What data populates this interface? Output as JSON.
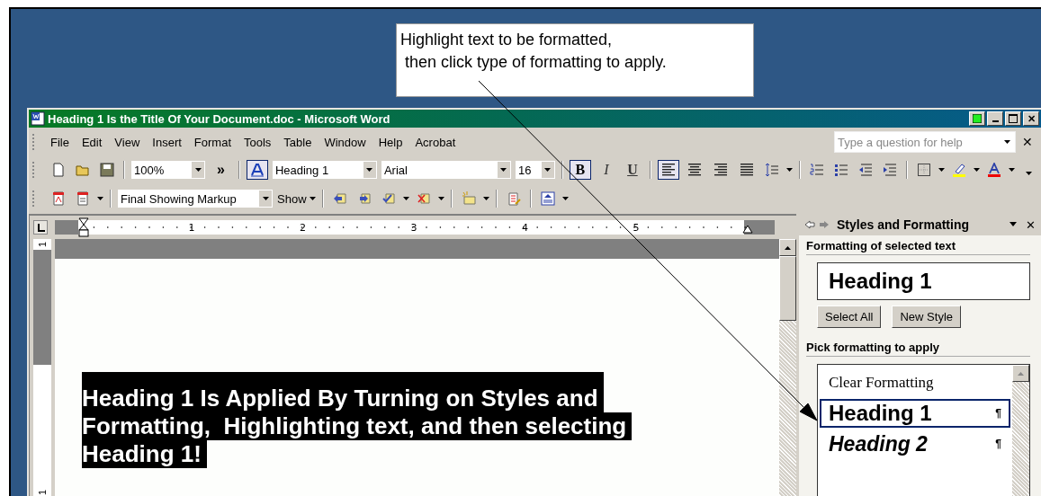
{
  "callout": {
    "lines": [
      "Highlight text to be formatted,",
      " then click type of formatting to apply."
    ]
  },
  "window": {
    "title": "Heading 1 Is the Title Of Your Document.doc - Microsoft Word",
    "close": "✕"
  },
  "menu": [
    "File",
    "Edit",
    "View",
    "Insert",
    "Format",
    "Tools",
    "Table",
    "Window",
    "Help",
    "Acrobat"
  ],
  "help_box": {
    "placeholder": "Type a question for help",
    "close": "✕"
  },
  "formatting_toolbar": {
    "zoom": "100%",
    "more": "»",
    "style": "Heading 1",
    "font": "Arial",
    "size": "16",
    "text_buttons": [
      {
        "label": "B",
        "kind": "bold",
        "on": true
      },
      {
        "label": "I",
        "kind": "italic",
        "on": false
      },
      {
        "label": "U",
        "kind": "underline",
        "on": false
      }
    ],
    "alignment": [
      {
        "kind": "left",
        "selected": true
      },
      {
        "kind": "center",
        "selected": false
      },
      {
        "kind": "right",
        "selected": false
      },
      {
        "kind": "justify",
        "selected": false
      }
    ]
  },
  "reviewing_toolbar": {
    "view": "Final Showing Markup",
    "show": "Show"
  },
  "ruler": {
    "numbers": [
      "1",
      "2",
      "3",
      "4",
      "5"
    ]
  },
  "vertical_ruler": {
    "numbers": [
      "1",
      "1"
    ]
  },
  "document": {
    "selected_lines": [
      "Heading 1 Is Applied By Turning on Styles and",
      "Formatting,  Highlighting text, and then selecting",
      "Heading 1!"
    ]
  },
  "task_pane": {
    "title": "Styles and Formatting",
    "close": "✕",
    "current_label": "Formatting of selected text",
    "current_style": "Heading 1",
    "buttons": [
      "Select All",
      "New Style"
    ],
    "pick_label": "Pick formatting to apply",
    "styles": [
      {
        "name": "Clear Formatting",
        "kind": "clear",
        "selected": false
      },
      {
        "name": "Heading 1",
        "kind": "heading1",
        "selected": true,
        "mark": "¶"
      },
      {
        "name": "Heading 2",
        "kind": "heading2",
        "selected": false,
        "mark": "¶"
      }
    ]
  }
}
